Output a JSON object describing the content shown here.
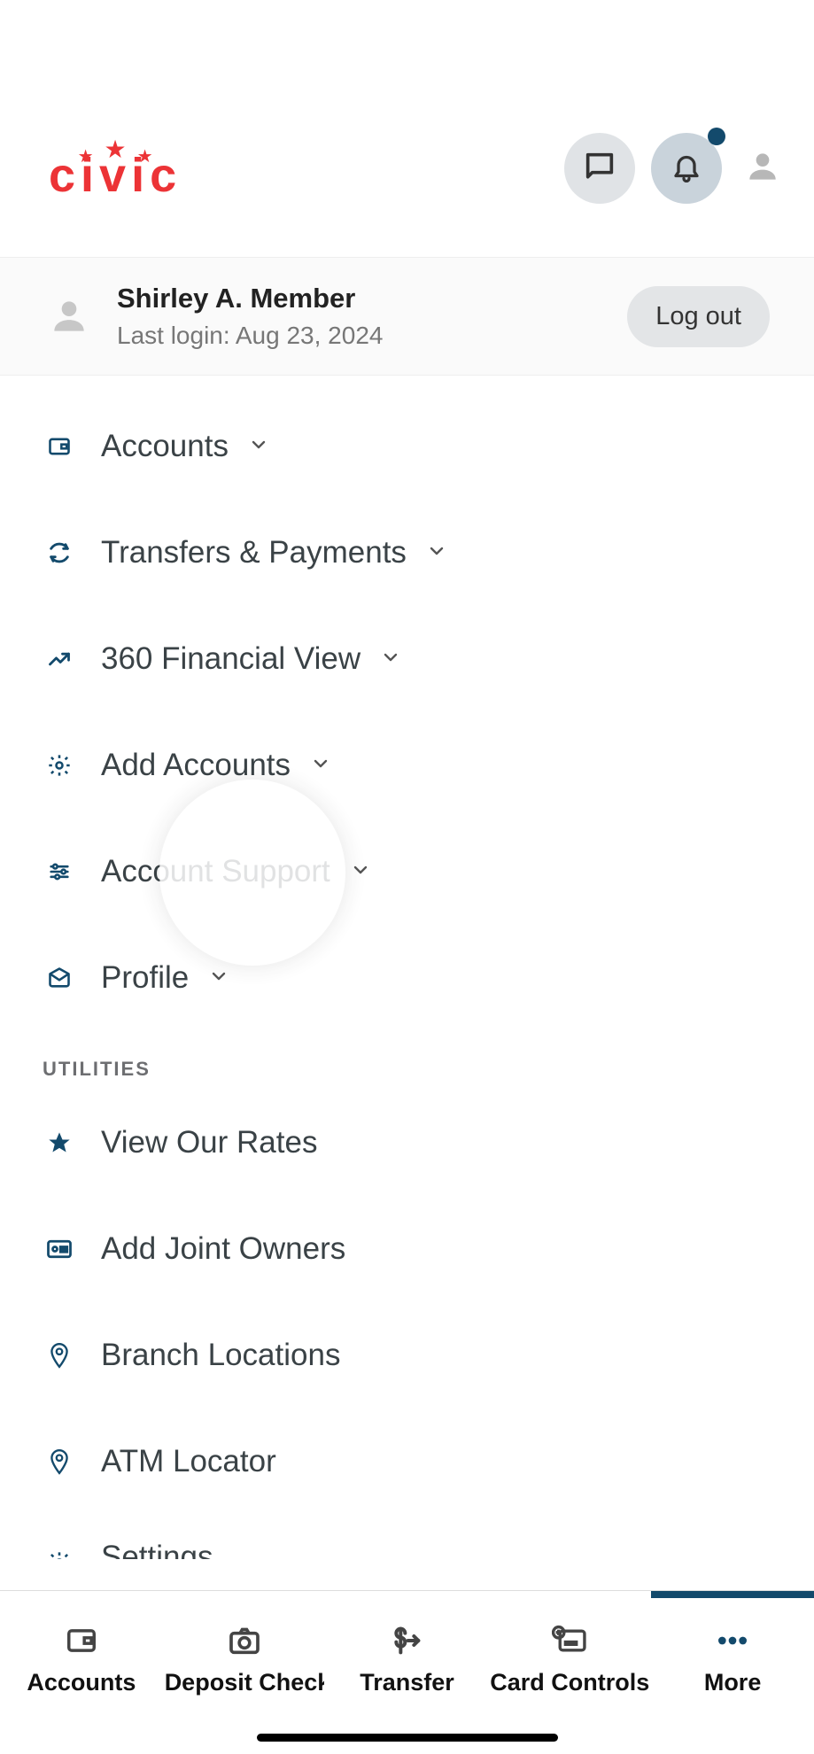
{
  "brand": "civic",
  "user": {
    "name": "Shirley A. Member",
    "last_login_label": "Last login: Aug 23, 2024",
    "logout": "Log out"
  },
  "menu": {
    "accounts": "Accounts",
    "transfers": "Transfers & Payments",
    "financial_view": "360 Financial View",
    "add_accounts": "Add Accounts",
    "account_support": "Account Support",
    "profile": "Profile"
  },
  "sections": {
    "utilities_header": "UTILITIES"
  },
  "utilities": {
    "rates": "View Our Rates",
    "joint": "Add Joint Owners",
    "branch": "Branch Locations",
    "atm": "ATM Locator",
    "settings": "Settings"
  },
  "nav": {
    "accounts": "Accounts",
    "deposit": "Deposit Check",
    "transfer": "Transfer",
    "card": "Card Controls",
    "more": "More"
  }
}
